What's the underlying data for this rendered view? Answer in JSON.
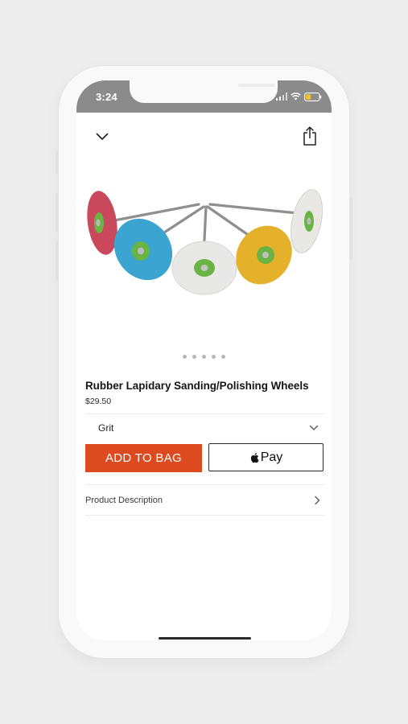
{
  "status_bar": {
    "time": "3:24",
    "signal_icon": "signal-bars-icon",
    "wifi_icon": "wifi-icon",
    "battery_icon": "battery-icon",
    "battery_color": "#f5c518"
  },
  "nav": {
    "collapse_icon": "chevron-down-icon",
    "share_icon": "share-icon"
  },
  "product": {
    "title": "Rubber Lapidary Sanding/Polishing Wheels",
    "price": "$29.50",
    "image_dots_count": 5,
    "wheel_colors": [
      "#c9485b",
      "#3ba4d1",
      "#e8e8e6",
      "#e5b12b",
      "#e9e8e4"
    ],
    "hub_color": "#6ab444"
  },
  "options": {
    "grit_label": "Grit",
    "grit_chevron_icon": "chevron-down-icon"
  },
  "actions": {
    "add_to_bag_label": "ADD TO BAG",
    "add_to_bag_color": "#dd4a1f",
    "apple_pay_label": "Pay",
    "apple_icon": "apple-logo-icon"
  },
  "description": {
    "label": "Product Description",
    "chevron_icon": "chevron-right-icon"
  }
}
